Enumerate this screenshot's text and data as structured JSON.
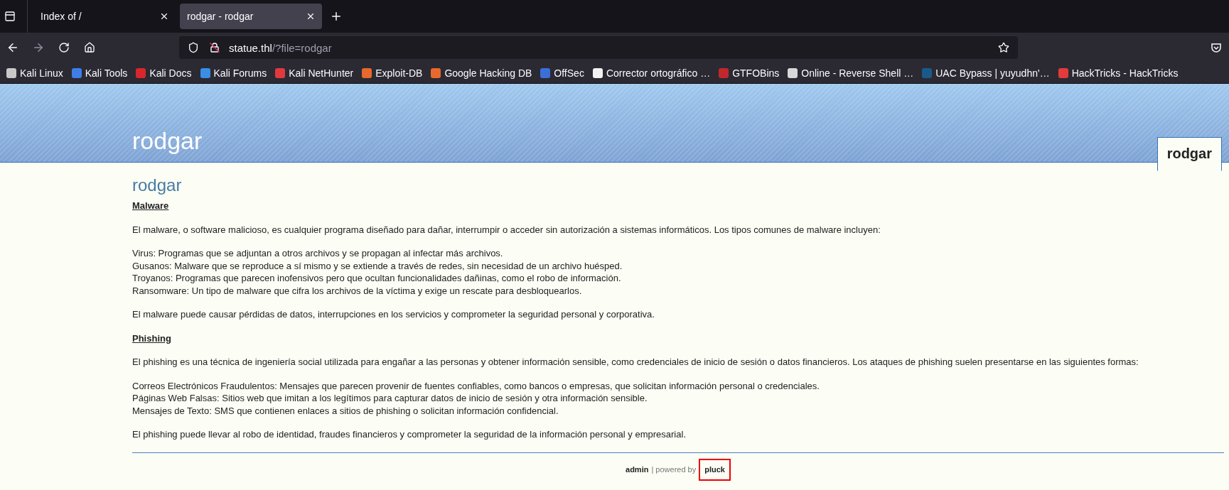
{
  "browser": {
    "tabs": [
      {
        "title": "Index of /",
        "selected": false
      },
      {
        "title": "rodgar - rodgar",
        "selected": true
      }
    ],
    "url": {
      "host": "statue.thl",
      "path": "/?file=rodgar"
    },
    "bookmarks": [
      {
        "label": "Kali Linux",
        "color": "#c8c8c8"
      },
      {
        "label": "Kali Tools",
        "color": "#3f7ee8"
      },
      {
        "label": "Kali Docs",
        "color": "#d8262c"
      },
      {
        "label": "Kali Forums",
        "color": "#3a8ee6"
      },
      {
        "label": "Kali NetHunter",
        "color": "#e0393e"
      },
      {
        "label": "Exploit-DB",
        "color": "#e8692c"
      },
      {
        "label": "Google Hacking DB",
        "color": "#e8692c"
      },
      {
        "label": "OffSec",
        "color": "#3b6fd8"
      },
      {
        "label": "Corrector ortográfico …",
        "color": "#f2f2f2"
      },
      {
        "label": "GTFOBins",
        "color": "#c0282c"
      },
      {
        "label": "Online - Reverse Shell …",
        "color": "#d8d8d8"
      },
      {
        "label": "UAC Bypass | yuyudhn'…",
        "color": "#1a5a8a"
      },
      {
        "label": "HackTricks - HackTricks",
        "color": "#e23b3b"
      }
    ]
  },
  "page": {
    "site_title": "rodgar",
    "nav_tabs": [
      {
        "label": "rodgar",
        "selected": true
      }
    ],
    "heading": "rodgar",
    "blocks": [
      {
        "kind": "subheading",
        "text": "Malware"
      },
      {
        "kind": "paragraph",
        "lines": [
          "El malware, o software malicioso, es cualquier programa diseñado para dañar, interrumpir o acceder sin autorización a sistemas informáticos. Los tipos comunes de malware incluyen:"
        ]
      },
      {
        "kind": "paragraph",
        "lines": [
          "Virus: Programas que se adjuntan a otros archivos y se propagan al infectar más archivos.",
          "Gusanos: Malware que se reproduce a sí mismo y se extiende a través de redes, sin necesidad de un archivo huésped.",
          "Troyanos: Programas que parecen inofensivos pero que ocultan funcionalidades dañinas, como el robo de información.",
          "Ransomware: Un tipo de malware que cifra los archivos de la víctima y exige un rescate para desbloquearlos."
        ]
      },
      {
        "kind": "paragraph",
        "lines": [
          "El malware puede causar pérdidas de datos, interrupciones en los servicios y comprometer la seguridad personal y corporativa."
        ]
      },
      {
        "kind": "subheading",
        "text": "Phishing"
      },
      {
        "kind": "paragraph",
        "lines": [
          "El phishing es una técnica de ingeniería social utilizada para engañar a las personas y obtener información sensible, como credenciales de inicio de sesión o datos financieros. Los ataques de phishing suelen presentarse en las siguientes formas:"
        ]
      },
      {
        "kind": "paragraph",
        "lines": [
          "Correos Electrónicos Fraudulentos: Mensajes que parecen provenir de fuentes confiables, como bancos o empresas, que solicitan información personal o credenciales.",
          "Páginas Web Falsas: Sitios web que imitan a los legítimos para capturar datos de inicio de sesión y otra información sensible.",
          "Mensajes de Texto: SMS que contienen enlaces a sitios de phishing o solicitan información confidencial."
        ]
      },
      {
        "kind": "paragraph",
        "lines": [
          "El phishing puede llevar al robo de identidad, fraudes financieros y comprometer la seguridad de la información personal y empresarial."
        ]
      }
    ],
    "footer": {
      "admin_link": "admin",
      "powered_text": "| powered by",
      "pluck_link": "pluck",
      "pluck_highlighted": true
    }
  }
}
